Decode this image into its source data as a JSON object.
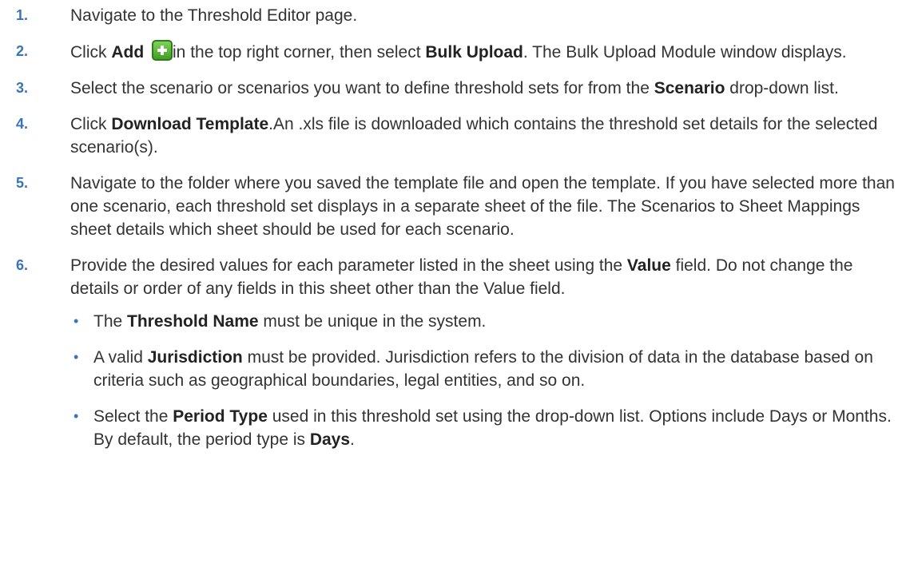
{
  "steps": [
    {
      "num": "1.",
      "text": "Navigate to the Threshold Editor page."
    },
    {
      "num": "2.",
      "click": "Click ",
      "add": "Add",
      "icon": "add-icon",
      "after_icon": "in the top right corner, then select ",
      "bulk": "Bulk Upload",
      "tail": ". The Bulk Upload Module window displays."
    },
    {
      "num": "3.",
      "text": "Select the scenario or scenarios you want to define threshold sets for from the ",
      "bold": "Scenario",
      "tail": " drop-down list."
    },
    {
      "num": "4.",
      "click": "Click ",
      "bold": "Download Template",
      "tail": ".An .xls file is downloaded which contains the threshold set details for the selected scenario(s)."
    },
    {
      "num": "5.",
      "text": "Navigate to the folder where you saved the template file and open the template. If you have selected more than one scenario, each threshold set displays in a separate sheet of the file. The Scenarios to Sheet Mappings sheet details which sheet should be used for each scenario."
    },
    {
      "num": "6.",
      "text": "Provide the desired values for each parameter listed in the sheet using the ",
      "bold": "Value",
      "tail": " field. Do not change the details or order of any fields in this sheet other than the Value field.",
      "bullets": [
        {
          "dot": "•",
          "pre": "The ",
          "bold": "Threshold Name",
          "tail": " must be unique in the system."
        },
        {
          "dot": "•",
          "pre": "A valid ",
          "bold": "Jurisdiction",
          "tail": " must be provided. Jurisdiction refers to the division of data in the database based on criteria such as geographical boundaries, legal entities, and so on."
        },
        {
          "dot": "•",
          "pre": "Select the ",
          "bold": "Period Type",
          "mid": " used in this threshold set using the drop-down list. Options include Days or Months. By default, the period type is ",
          "bold2": "Days",
          "tail": "."
        }
      ]
    }
  ]
}
